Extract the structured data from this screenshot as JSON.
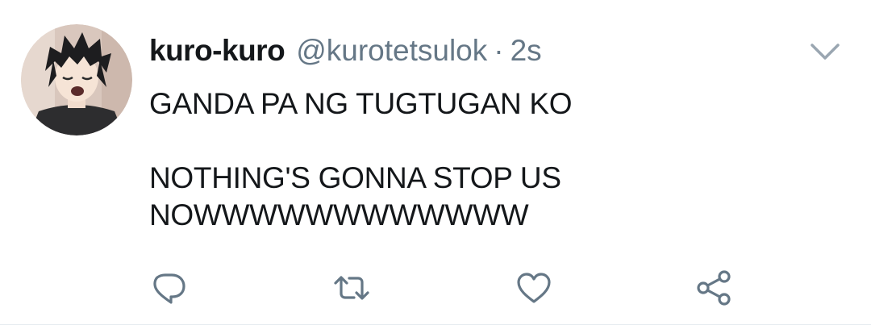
{
  "tweet": {
    "display_name": "kuro-kuro",
    "handle": "@kurotetsulok",
    "separator": "·",
    "timestamp": "2s",
    "text_lines": [
      "GANDA PA NG TUGTUGAN KO",
      "NOTHING'S GONNA STOP US",
      "NOWWWWWWWWWWWW"
    ]
  },
  "actions": [
    {
      "name": "reply",
      "icon": "reply-icon"
    },
    {
      "name": "retweet",
      "icon": "retweet-icon"
    },
    {
      "name": "like",
      "icon": "heart-icon"
    },
    {
      "name": "share",
      "icon": "share-icon"
    }
  ],
  "colors": {
    "primary_text": "#14171a",
    "secondary_text": "#657786",
    "icon_gray": "#657786",
    "divider": "#e6ecf0"
  }
}
